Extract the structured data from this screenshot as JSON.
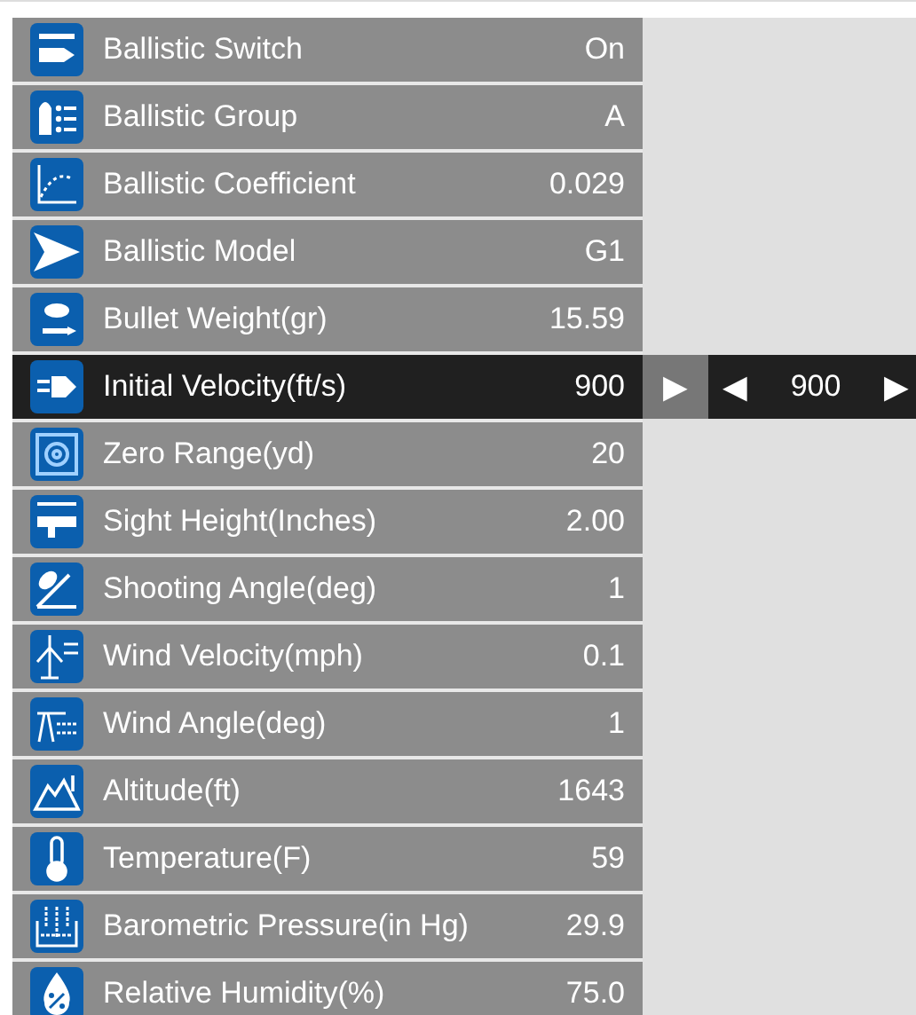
{
  "settings": [
    {
      "label": "Ballistic Switch",
      "value": "On",
      "selected": false
    },
    {
      "label": "Ballistic Group",
      "value": "A",
      "selected": false
    },
    {
      "label": "Ballistic Coefficient",
      "value": "0.029",
      "selected": false
    },
    {
      "label": "Ballistic Model",
      "value": "G1",
      "selected": false
    },
    {
      "label": "Bullet Weight(gr)",
      "value": "15.59",
      "selected": false
    },
    {
      "label": "Initial Velocity(ft/s)",
      "value": "900",
      "selected": true
    },
    {
      "label": "Zero Range(yd)",
      "value": "20",
      "selected": false
    },
    {
      "label": "Sight Height(Inches)",
      "value": "2.00",
      "selected": false
    },
    {
      "label": "Shooting Angle(deg)",
      "value": "1",
      "selected": false
    },
    {
      "label": "Wind Velocity(mph)",
      "value": "0.1",
      "selected": false
    },
    {
      "label": "Wind Angle(deg)",
      "value": "1",
      "selected": false
    },
    {
      "label": "Altitude(ft)",
      "value": "1643",
      "selected": false
    },
    {
      "label": "Temperature(F)",
      "value": "59",
      "selected": false
    },
    {
      "label": "Barometric Pressure(in Hg)",
      "value": "29.9",
      "selected": false
    },
    {
      "label": "Relative Humidity(%)",
      "value": "75.0",
      "selected": false
    }
  ],
  "editor": {
    "expand_arrow": "▶",
    "decrease": "◀",
    "value": "900",
    "increase": "▶"
  }
}
